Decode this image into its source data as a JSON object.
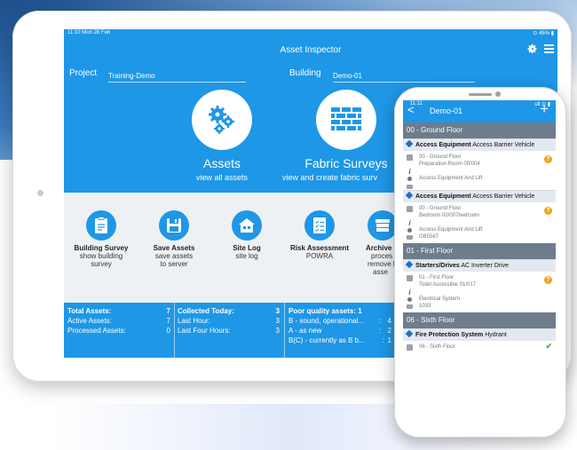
{
  "tablet": {
    "status_time": "11:10  Mon 28 Feb",
    "status_right": "⊙ 45% ▮",
    "app_title": "Asset Inspector",
    "project_label": "Project",
    "project_value": "Training-Demo",
    "building_label": "Building",
    "building_value": "Demo-01",
    "assets_title": "Assets",
    "assets_sub": "view all assets",
    "fabric_title": "Fabric Surveys",
    "fabric_sub": "view and create fabric surv",
    "tools": [
      {
        "title": "Building Survey",
        "sub1": "show building",
        "sub2": "survey",
        "icon": "clipboard-icon"
      },
      {
        "title": "Save Assets",
        "sub1": "save assets",
        "sub2": "to server",
        "icon": "floppy-disk-icon"
      },
      {
        "title": "Site Log",
        "sub1": "site log",
        "sub2": "",
        "icon": "house-icon"
      },
      {
        "title": "Risk Assessment",
        "sub1": "POWRA",
        "sub2": "",
        "icon": "checklist-icon"
      },
      {
        "title": "Archive I",
        "sub1": "proces",
        "sub2": "remove l",
        "sub3": "asse",
        "icon": "archive-icon"
      }
    ],
    "stats": {
      "total_label": "Total Assets:",
      "total_value": "7",
      "active_label": "Active Assets:",
      "active_value": "7",
      "processed_label": "Processed Assets:",
      "processed_value": "0",
      "collected_label": "Collected Today:",
      "collected_value": "3",
      "last_hour_label": "Last Hour:",
      "last_hour_value": "3",
      "last_four_label": "Last Four Hours:",
      "last_four_value": "3",
      "poor_label": "Poor quality assets: 1",
      "b_label": "B - sound, operational...",
      "b_sep": ":",
      "b_value": "4",
      "a_label": "A - as new",
      "a_sep": ":",
      "a_value": "2",
      "bc_label": "B(C) - currently as B b...",
      "bc_sep": ":",
      "bc_value": "1"
    }
  },
  "phone": {
    "status_left": "11:11",
    "status_right": "ull ⊙ ▮",
    "back": "<",
    "title": "Demo-01",
    "plus": "+",
    "ground_floor": "00 - Ground Floor",
    "cat1_bold": "Access Equipment",
    "cat1_rest": "Access Barrier Vehicle",
    "item1_line1": "00 - Ground Floor",
    "item1_line2": "Preparation Room    00/004",
    "item1_line3": "Access Equipment And Lift",
    "cat2_bold": "Access Equipment",
    "cat2_rest": "Access Barrier Vehicle",
    "item2_line1": "00 - Ground Floor",
    "item2_line2": "Bedroom    00/007bedroom",
    "item2_line3": "Access Equipment And Lift",
    "item2_line4": "GB5567",
    "first_floor": "01 - First Floor",
    "cat3_bold": "Starters/Drives",
    "cat3_rest": "AC Inverter Drive",
    "item3_line1": "01 - First Floor",
    "item3_line2": "Toilet Accessible    01/017",
    "item3_line3": "Electrical System",
    "item3_line4": "1033",
    "sixth_floor": "06 - Sixth Floor",
    "cat4_bold": "Fire Protection System",
    "cat4_rest": "Hydrant",
    "item4_line1": "06 - Sixth Floor",
    "warn": "?",
    "ok": "✔"
  }
}
